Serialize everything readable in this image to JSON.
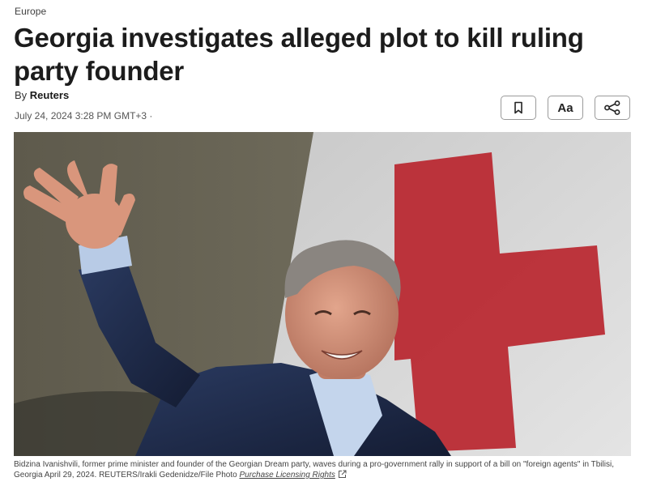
{
  "article": {
    "section": "Europe",
    "headline": "Georgia investigates alleged plot to kill ruling party founder",
    "byline_prefix": "By",
    "author": "Reuters",
    "date": "July 24, 2024 3:28 PM GMT+3 ·"
  },
  "toolbar": {
    "bookmark_icon": "bookmark-icon",
    "text_size_label": "Aa",
    "share_icon": "share-icon"
  },
  "photo": {
    "description_icon": "photo",
    "caption": "Bidzina Ivanishvili, former prime minister and founder of the Georgian Dream party, waves during a pro-government rally in support of a bill on \"foreign agents\" in Tbilisi, Georgia April 29, 2024. REUTERS/Irakli Gedenidze/File Photo",
    "licensing_label": "Purchase Licensing Rights",
    "external_link_icon": "external-link-icon"
  },
  "colors": {
    "flag_red": "#b8212a",
    "suit_blue": "#1f2b4a",
    "text_dark": "#1c1c1c",
    "button_border": "#9a9a9a"
  }
}
